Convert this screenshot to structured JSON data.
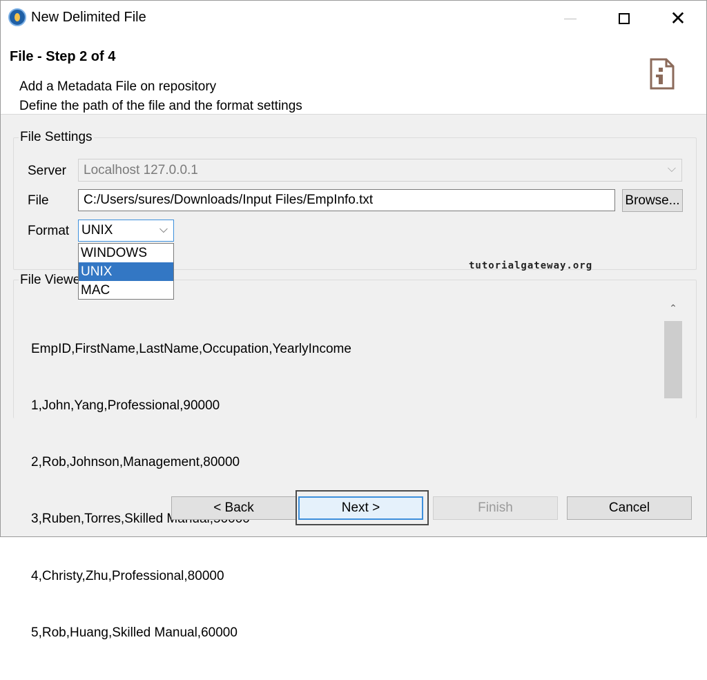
{
  "window": {
    "title": "New Delimited File",
    "controls": {
      "minimize": "minimize",
      "maximize": "maximize",
      "close": "close"
    }
  },
  "header": {
    "step_title": "File - Step 2 of 4",
    "description_line1": "Add a Metadata File on repository",
    "description_line2": "Define the path of the file and the format settings"
  },
  "file_settings": {
    "group_label": "File Settings",
    "server_label": "Server",
    "server_value": "Localhost 127.0.0.1",
    "file_label": "File",
    "file_value": "C:/Users/sures/Downloads/Input Files/EmpInfo.txt",
    "browse_label": "Browse...",
    "format_label": "Format",
    "format_value": "UNIX",
    "format_options": [
      "WINDOWS",
      "UNIX",
      "MAC"
    ],
    "format_selected_index": 1
  },
  "watermark": "tutorialgateway.org",
  "file_viewer": {
    "group_label": "File Viewer",
    "lines": [
      "EmpID,FirstName,LastName,Occupation,YearlyIncome",
      "1,John,Yang,Professional,90000",
      "2,Rob,Johnson,Management,80000",
      "3,Ruben,Torres,Skilled Manual,50000",
      "4,Christy,Zhu,Professional,80000",
      "5,Rob,Huang,Skilled Manual,60000"
    ]
  },
  "buttons": {
    "back": "< Back",
    "next": "Next >",
    "finish": "Finish",
    "cancel": "Cancel"
  },
  "icons": {
    "app": "talend-app-icon",
    "header": "file-info-icon",
    "server_chevron": "chevron-down-icon",
    "format_chevron": "chevron-down-icon",
    "scroll_up": "scroll-up-arrow-icon"
  },
  "colors": {
    "selection": "#3377c4",
    "focus_border": "#3c8fdc",
    "dialog_bg": "#f0f0f0",
    "header_icon": "#8b6a5a"
  }
}
